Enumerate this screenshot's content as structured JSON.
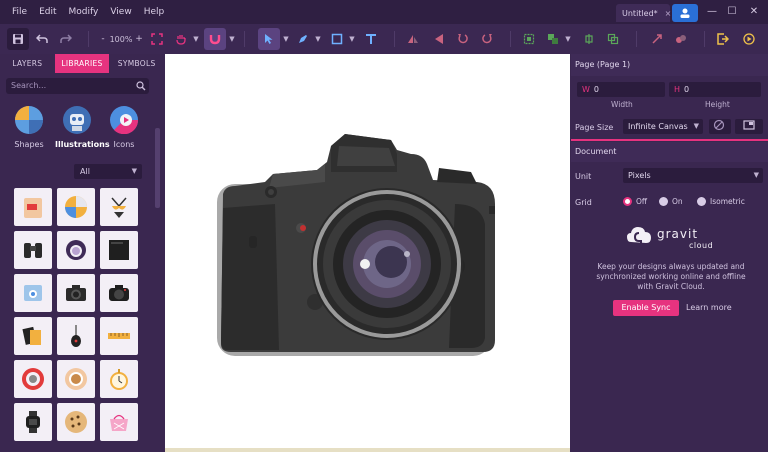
{
  "menu": [
    "File",
    "Edit",
    "Modify",
    "View",
    "Help"
  ],
  "document_tab": {
    "title": "Untitled*",
    "close": "×"
  },
  "window": {
    "minimize": "—",
    "maximize": "☐",
    "close": "✕"
  },
  "toolbar": {
    "zoom": "100%",
    "zoom_minus": "-",
    "zoom_plus": "+"
  },
  "left_panel": {
    "tabs": [
      "LAYERS",
      "LIBRARIES",
      "SYMBOLS"
    ],
    "selected_tab": "LIBRARIES",
    "search_placeholder": "Search...",
    "categories": [
      {
        "label": "Shapes",
        "color": "#e9a33c"
      },
      {
        "label": "Illustrations",
        "color": "#3f6fb5"
      },
      {
        "label": "Icons",
        "color": "#4d8fe0"
      }
    ],
    "filter": "All"
  },
  "right_panel": {
    "page_header": "Page (Page 1)",
    "width_letter": "W",
    "width_value": "0",
    "height_letter": "H",
    "height_value": "0",
    "width_label": "Width",
    "height_label": "Height",
    "page_size_label": "Page Size",
    "page_size_value": "Infinite Canvas",
    "document_header": "Document",
    "unit_label": "Unit",
    "unit_value": "Pixels",
    "grid_label": "Grid",
    "grid_options": [
      "Off",
      "On",
      "Isometric"
    ],
    "grid_selected": "Off",
    "cloud_brand_line1": "gravit",
    "cloud_brand_line2": "cloud",
    "cloud_message": "Keep your designs always updated and synchronized working online and offline with Gravit Cloud.",
    "enable_sync": "Enable Sync",
    "learn_more": "Learn more"
  },
  "colors": {
    "accent": "#e6337f",
    "panel": "#3a2750",
    "bar": "#2f1f42"
  }
}
